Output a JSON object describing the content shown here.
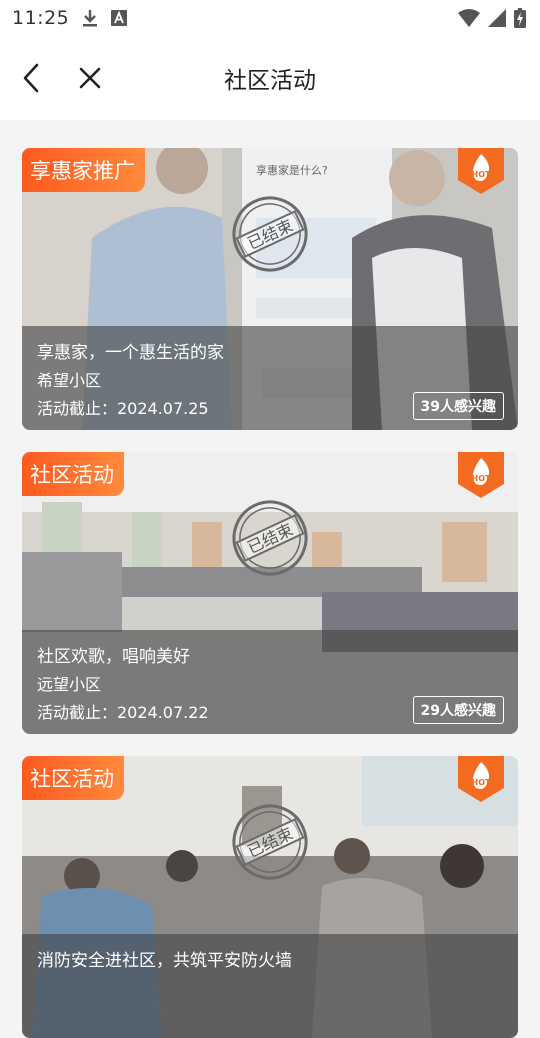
{
  "status": {
    "time": "11:25"
  },
  "nav": {
    "title": "社区活动"
  },
  "activities": [
    {
      "tag": "享惠家推广",
      "title": "享惠家，一个惠生活的家",
      "place": "希望小区",
      "deadline": "活动截止：2024.07.25",
      "interest": "39人感兴趣",
      "photo_board_text": "享惠家是什么?"
    },
    {
      "tag": "社区活动",
      "title": "社区欢歌，唱响美好",
      "place": "远望小区",
      "deadline": "活动截止：2024.07.22",
      "interest": "29人感兴趣"
    },
    {
      "tag": "社区活动",
      "title": "消防安全进社区，共筑平安防火墙",
      "place": "",
      "deadline": "",
      "interest": ""
    }
  ],
  "badges": {
    "hot": "HOT",
    "ended": "已结束"
  },
  "colors": {
    "tag_start": "#ff5a1f",
    "tag_end": "#ff8a3c",
    "hot": "#f36b21"
  }
}
